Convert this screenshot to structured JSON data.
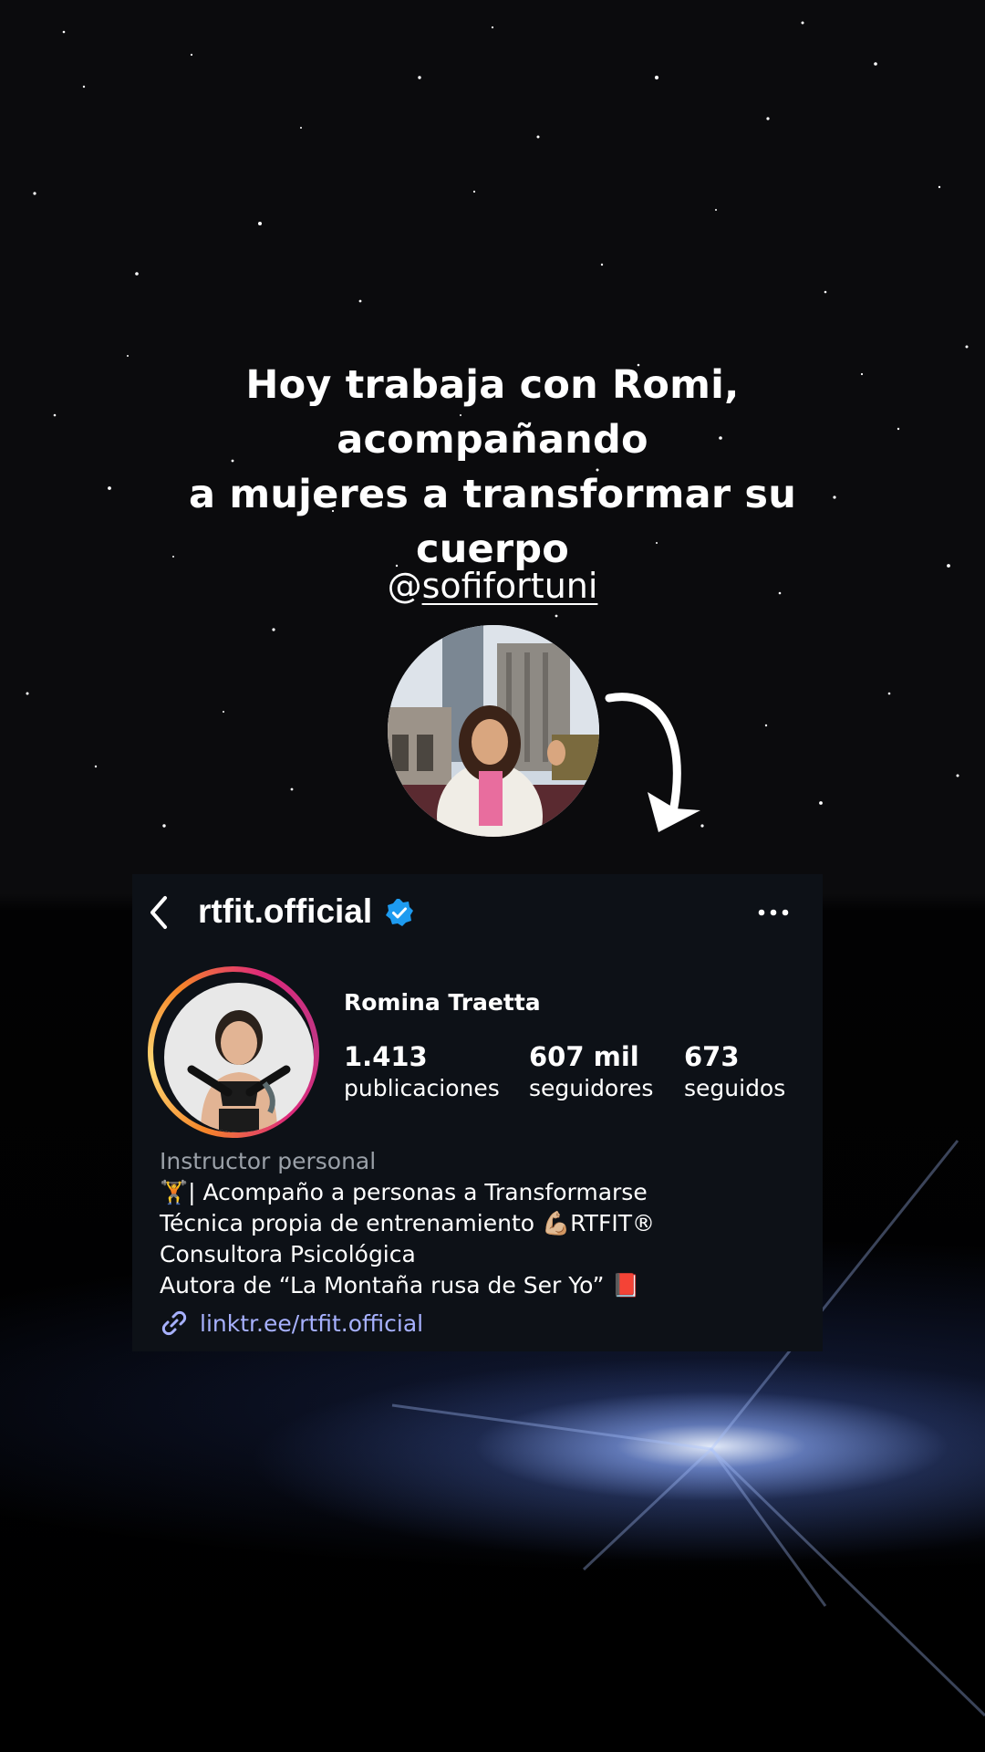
{
  "headline": {
    "line1": "Hoy trabaja con Romi, acompañando",
    "line2": "a mujeres a transformar su cuerpo"
  },
  "handle": {
    "at": "@",
    "name": "sofifortuni"
  },
  "profile_card": {
    "username": "rtfit.official",
    "verified": true,
    "display_name": "Romina Traetta",
    "stats": [
      {
        "value": "1.413",
        "label": "publicaciones"
      },
      {
        "value": "607 mil",
        "label": "seguidores"
      },
      {
        "value": "673",
        "label": "seguidos"
      }
    ],
    "bio": {
      "category": "Instructor personal",
      "lines": [
        "🏋️| Acompaño a personas a Transformarse",
        "Técnica propia de entrenamiento 💪🏼RTFIT®",
        "Consultora Psicológica",
        "Autora de “La Montaña rusa de Ser Yo” 📕"
      ]
    },
    "link": "linktr.ee/rtfit.official"
  },
  "icons": [
    "back-arrow-icon",
    "verified-badge-icon",
    "more-options-icon",
    "link-icon",
    "curved-arrow-icon"
  ],
  "colors": {
    "card_background": "#0d1117",
    "link": "#a7b1ff",
    "verified": "#1d9bf0",
    "glow": "#5f82e6"
  }
}
